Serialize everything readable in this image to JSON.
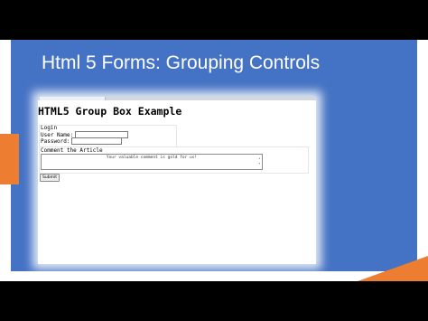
{
  "slide": {
    "title": "Html 5 Forms: Grouping Controls"
  },
  "demo": {
    "heading": "HTML5 Group Box Example",
    "login_legend": "Login",
    "username_label": "User Name:",
    "password_label": "Password:",
    "comment_legend": "Comment the Article",
    "comment_placeholder": "Your valuable comment is gold for us!",
    "submit_label": "Submit"
  },
  "colors": {
    "slide_background": "#ffffff",
    "panel": "#4472c4",
    "accent": "#ed7d31",
    "title_text": "#ffffff"
  }
}
